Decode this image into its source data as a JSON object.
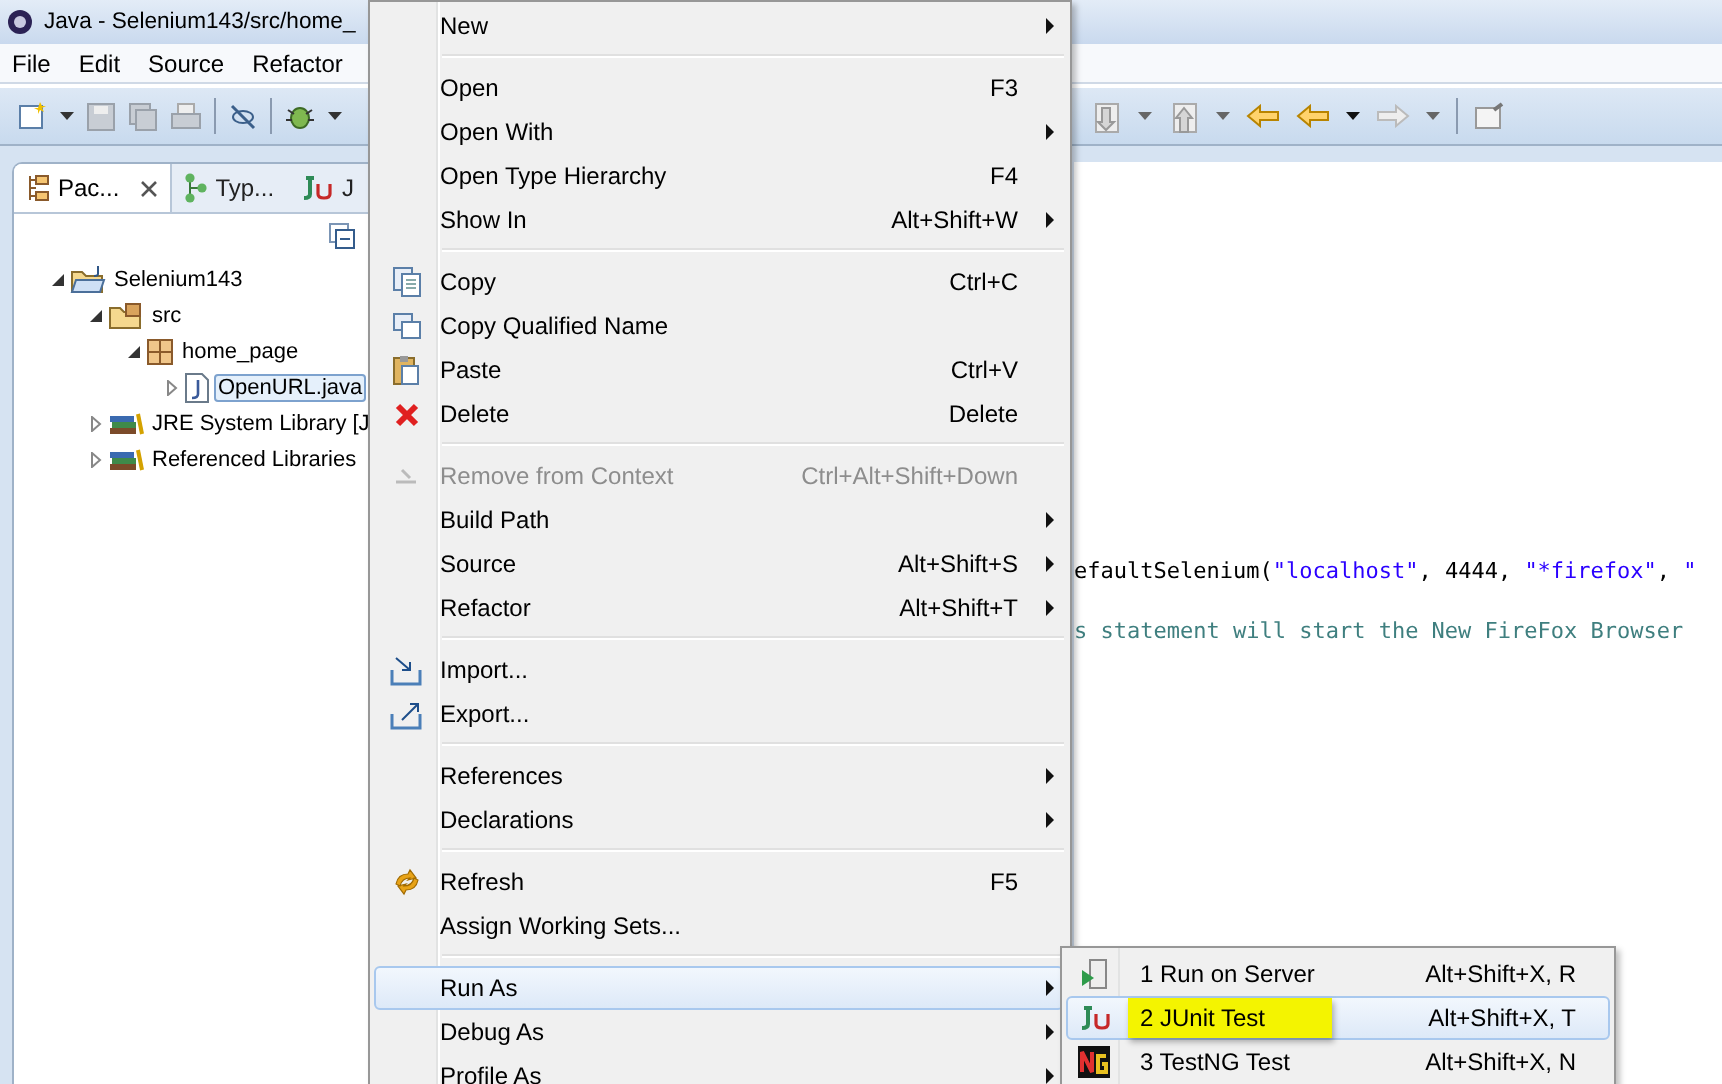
{
  "window": {
    "title": "Java - Selenium143/src/home_"
  },
  "menu_bar": [
    "File",
    "Edit",
    "Source",
    "Refactor"
  ],
  "package_explorer": {
    "tabs": [
      {
        "label": "Pac...",
        "selected": true,
        "closable": true
      },
      {
        "label": "Typ...",
        "selected": false,
        "closable": false
      },
      {
        "label": "J",
        "selected": false,
        "closable": false
      }
    ],
    "tree": [
      {
        "label": "Selenium143",
        "expanded": true,
        "selected": false,
        "children": [
          {
            "label": "src",
            "expanded": true,
            "selected": false,
            "children": [
              {
                "label": "home_page",
                "expanded": true,
                "selected": false,
                "children": [
                  {
                    "label": "OpenURL.java",
                    "expanded": false,
                    "selected": true
                  }
                ]
              }
            ]
          },
          {
            "label": "JRE System Library [J",
            "expanded": false,
            "selected": false
          },
          {
            "label": "Referenced Libraries",
            "expanded": false,
            "selected": false
          }
        ]
      }
    ]
  },
  "editor": {
    "lines": [
      [
        {
          "kind": "plain",
          "text": "efaultSelenium("
        },
        {
          "kind": "string",
          "text": "\"localhost\""
        },
        {
          "kind": "plain",
          "text": ", 4444, "
        },
        {
          "kind": "string",
          "text": "\"*firefox\""
        },
        {
          "kind": "plain",
          "text": ", "
        },
        {
          "kind": "string",
          "text": "\""
        }
      ],
      [
        {
          "kind": "comment",
          "text": "s statement will start the New FireFox Browser"
        }
      ]
    ]
  },
  "context_menu": {
    "groups": [
      [
        {
          "label": "New",
          "submenu": true,
          "disabled": false,
          "selected": false
        }
      ],
      [
        {
          "label": "Open",
          "shortcut": "F3",
          "submenu": false,
          "disabled": false,
          "selected": false
        },
        {
          "label": "Open With",
          "submenu": true,
          "disabled": false,
          "selected": false
        },
        {
          "label": "Open Type Hierarchy",
          "shortcut": "F4",
          "submenu": false,
          "disabled": false,
          "selected": false
        },
        {
          "label": "Show In",
          "shortcut": "Alt+Shift+W",
          "submenu": true,
          "disabled": false,
          "selected": false
        }
      ],
      [
        {
          "label": "Copy",
          "shortcut": "Ctrl+C",
          "submenu": false,
          "disabled": false,
          "selected": false
        },
        {
          "label": "Copy Qualified Name",
          "submenu": false,
          "disabled": false,
          "selected": false
        },
        {
          "label": "Paste",
          "shortcut": "Ctrl+V",
          "submenu": false,
          "disabled": false,
          "selected": false
        },
        {
          "label": "Delete",
          "shortcut": "Delete",
          "submenu": false,
          "disabled": false,
          "selected": false
        }
      ],
      [
        {
          "label": "Remove from Context",
          "shortcut": "Ctrl+Alt+Shift+Down",
          "submenu": false,
          "disabled": true,
          "selected": false
        },
        {
          "label": "Build Path",
          "submenu": true,
          "disabled": false,
          "selected": false
        },
        {
          "label": "Source",
          "shortcut": "Alt+Shift+S",
          "submenu": true,
          "disabled": false,
          "selected": false
        },
        {
          "label": "Refactor",
          "shortcut": "Alt+Shift+T",
          "submenu": true,
          "disabled": false,
          "selected": false
        }
      ],
      [
        {
          "label": "Import...",
          "submenu": false,
          "disabled": false,
          "selected": false
        },
        {
          "label": "Export...",
          "submenu": false,
          "disabled": false,
          "selected": false
        }
      ],
      [
        {
          "label": "References",
          "submenu": true,
          "disabled": false,
          "selected": false
        },
        {
          "label": "Declarations",
          "submenu": true,
          "disabled": false,
          "selected": false
        }
      ],
      [
        {
          "label": "Refresh",
          "shortcut": "F5",
          "submenu": false,
          "disabled": false,
          "selected": false
        },
        {
          "label": "Assign Working Sets...",
          "submenu": false,
          "disabled": false,
          "selected": false
        }
      ],
      [
        {
          "label": "Run As",
          "submenu": true,
          "disabled": false,
          "selected": true
        },
        {
          "label": "Debug As",
          "submenu": true,
          "disabled": false,
          "selected": false
        },
        {
          "label": "Profile As",
          "submenu": true,
          "disabled": false,
          "selected": false
        }
      ]
    ]
  },
  "run_as_menu": {
    "items": [
      {
        "label": "1 Run on Server",
        "shortcut": "Alt+Shift+X, R",
        "selected": false,
        "highlighted": false
      },
      {
        "label": "2 JUnit Test",
        "shortcut": "Alt+Shift+X, T",
        "selected": true,
        "highlighted": true
      },
      {
        "label": "3 TestNG Test",
        "shortcut": "Alt+Shift+X, N",
        "selected": false,
        "highlighted": false
      }
    ]
  }
}
